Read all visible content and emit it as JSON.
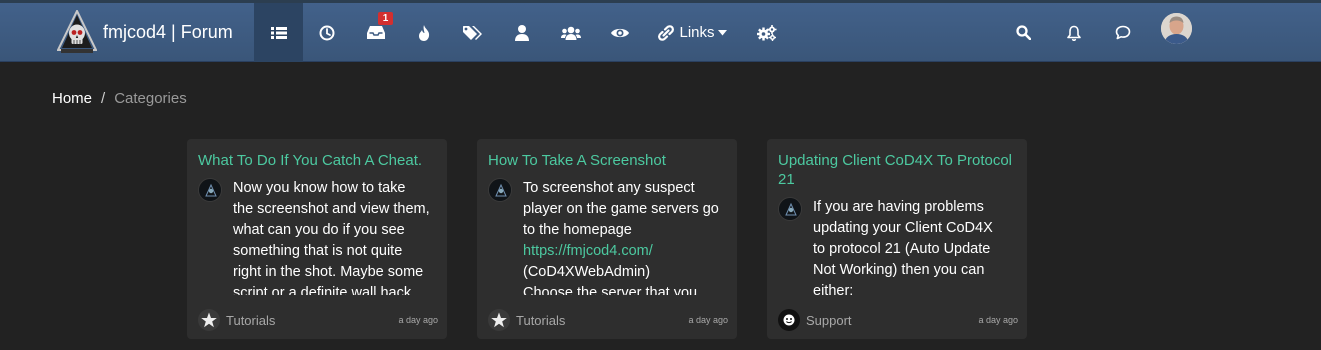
{
  "brand": {
    "title": "fmjcod4 | Forum"
  },
  "nav": {
    "items": [
      {
        "name": "categories",
        "icon": "list-icon"
      },
      {
        "name": "recent",
        "icon": "clock-icon"
      },
      {
        "name": "unread",
        "icon": "inbox-icon",
        "badge": "1"
      },
      {
        "name": "popular",
        "icon": "fire-icon"
      },
      {
        "name": "tags",
        "icon": "tags-icon"
      },
      {
        "name": "users",
        "icon": "user-icon"
      },
      {
        "name": "groups",
        "icon": "group-icon"
      },
      {
        "name": "watched",
        "icon": "eye-icon"
      },
      {
        "name": "links",
        "icon": "link-icon",
        "label": "Links"
      },
      {
        "name": "admin",
        "icon": "cogs-icon"
      }
    ],
    "right": [
      {
        "name": "search",
        "icon": "search-icon"
      },
      {
        "name": "notifications",
        "icon": "bell-icon"
      },
      {
        "name": "chats",
        "icon": "comment-icon"
      }
    ]
  },
  "breadcrumb": {
    "home": "Home",
    "separator": "/",
    "current": "Categories"
  },
  "cards": [
    {
      "title": "What To Do If You Catch A Cheat.",
      "body_lines": [
        "Now you know how to take",
        "the screenshot and view them,",
        "what can you do if you see",
        "something that is not quite",
        "right in the shot. Maybe some",
        "script or a definite wall hack"
      ],
      "category": "Tutorials",
      "category_icon": "star-icon",
      "time": "a day ago"
    },
    {
      "title": "How To Take A Screenshot",
      "body_lines": [
        "To screenshot any suspect",
        "player on the game servers go",
        "to the homepage"
      ],
      "link": "https://fmjcod4.com/",
      "body_after": [
        "(CoD4XWebAdmin)",
        "Choose the server that you"
      ],
      "category": "Tutorials",
      "category_icon": "star-icon",
      "time": "a day ago"
    },
    {
      "title": "Updating Client CoD4X To Protocol 21",
      "body_lines": [
        "If you are having problems",
        "updating your Client CoD4X",
        "to protocol 21 (Auto Update",
        "Not Working) then you can",
        "either:"
      ],
      "category": "Support",
      "category_icon": "support-icon",
      "time": "a day ago"
    }
  ],
  "colors": {
    "navbar": "#3d5a80",
    "accent": "#4cc9a0",
    "background": "#222222",
    "card": "#2e2e2e",
    "badge": "#d32f2f"
  }
}
